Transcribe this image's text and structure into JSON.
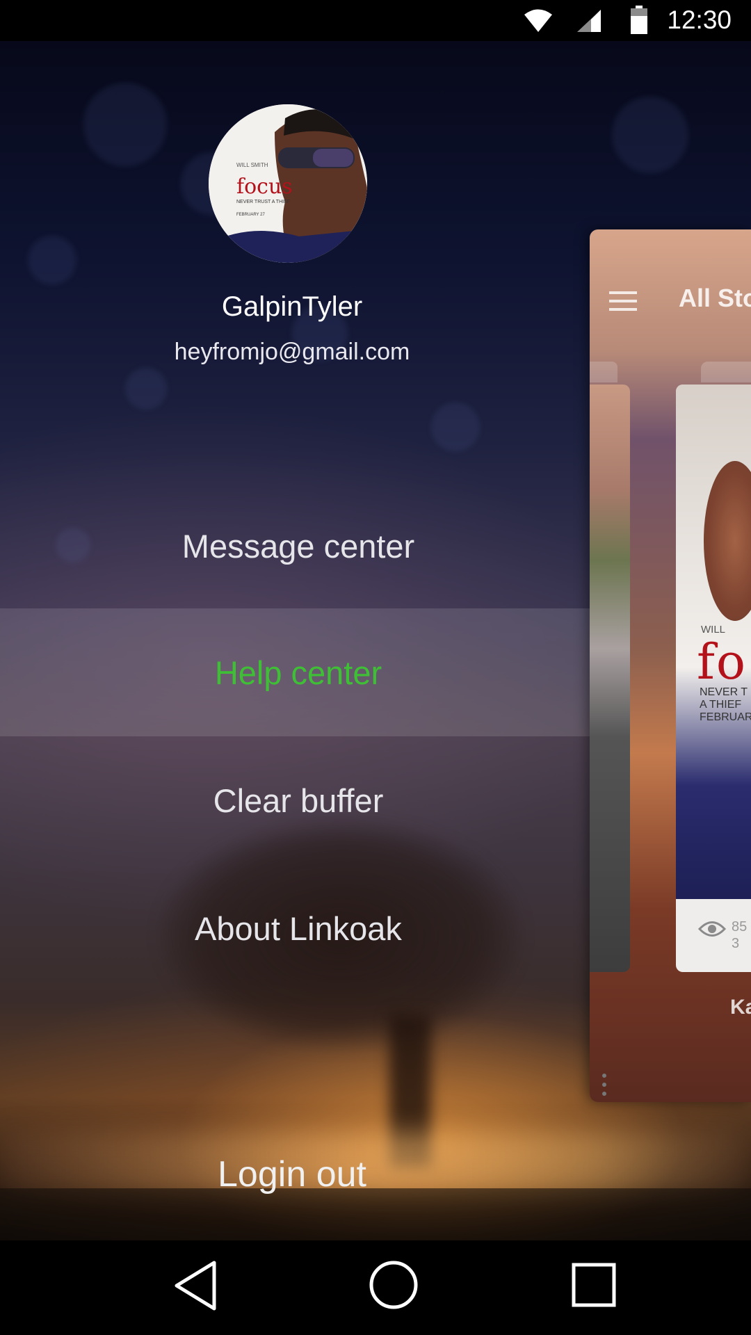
{
  "status_bar": {
    "time": "12:30"
  },
  "drawer": {
    "user": {
      "name": "GalpinTyler",
      "email": "heyfromjo@gmail.com"
    },
    "menu": [
      {
        "label": "Message center",
        "active": false
      },
      {
        "label": "Help center",
        "active": true
      },
      {
        "label": "Clear buffer",
        "active": false
      },
      {
        "label": "About Linkoak",
        "active": false
      }
    ],
    "logout_label": "Login out",
    "avatar_poster": {
      "actor": "WILL SMITH",
      "title": "focus",
      "tagline": "NEVER TRUST\nA THIEF",
      "date": "FEBRUARY 27"
    }
  },
  "main_peek": {
    "title": "All Sto",
    "poster": {
      "actor": "WILL",
      "title": "fo",
      "tagline": "NEVER T\nA THIEF\nFEBRUARY"
    },
    "view_count": "85\n3",
    "bottom_label": "Ka"
  },
  "colors": {
    "accent_active": "#3fbf36",
    "menu_text": "#e6e6ea"
  }
}
